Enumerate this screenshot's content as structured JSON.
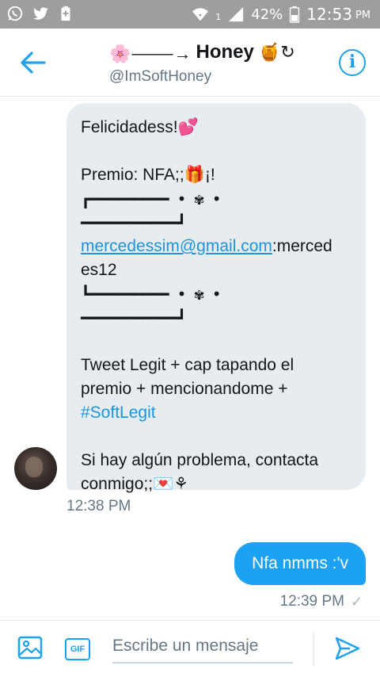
{
  "status_bar": {
    "battery": "42%",
    "time": "12:53",
    "ampm": "PM",
    "sim_label": "1",
    "icons": [
      "whatsapp-icon",
      "twitter-icon",
      "battery-saver-icon",
      "wifi-icon",
      "signal-icon",
      "battery-icon"
    ]
  },
  "header": {
    "name": "Honey",
    "name_prefix_emoji": "🌸⸻→",
    "name_suffix_emoji": "🍯↻",
    "handle": "@ImSoftHoney",
    "info_symbol": "i"
  },
  "conversation": {
    "incoming": {
      "lines": {
        "l1": "Felicidadess!💕",
        "l2": "",
        "l3": "Premio: NFA;;🎁¡!",
        "l4": "┏━━━━━━━━━ • ✾ •",
        "l5": "━━━━━━━━━━━┛",
        "l6_link": "mercedessim@gmail.com",
        "l6_rest": ":merced",
        "l7": "es12",
        "l8": "┗━━━━━━━━━ • ✾ •",
        "l9": "━━━━━━━━━━━┛",
        "l10": "",
        "l11": "Tweet Legit + cap tapando el",
        "l12": "premio + mencionandome +",
        "l13_tag": "#SoftLegit",
        "l14": "",
        "l15": "Si hay algún problema, contacta",
        "l16": "conmigo;;💌⚘"
      },
      "time": "12:38 PM"
    },
    "outgoing": {
      "text": "Nfa nmms :'v",
      "time": "12:39 PM",
      "status_symbol": "✓"
    }
  },
  "composer": {
    "placeholder": "Escribe un mensaje",
    "gif_label": "GIF"
  },
  "colors": {
    "accent": "#1da1f2",
    "bubble_in": "#e6ecf0",
    "status_bar": "#9e9e9e",
    "muted_text": "#657786"
  }
}
